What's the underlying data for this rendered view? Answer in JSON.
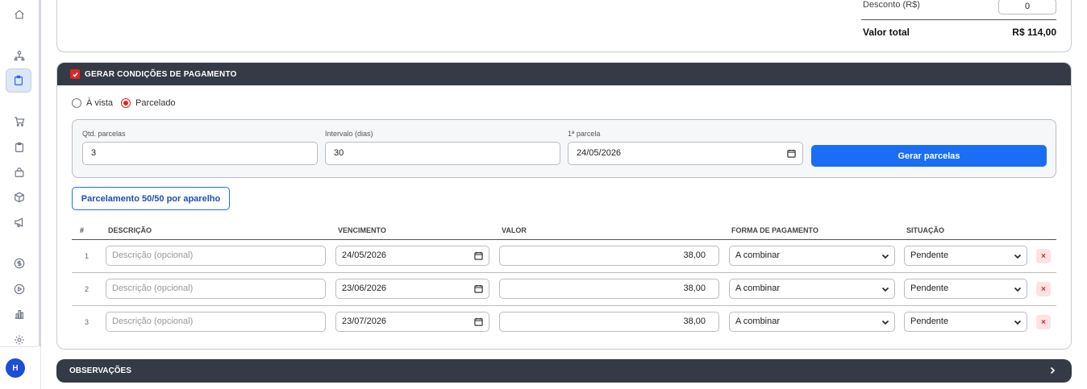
{
  "sidebar": {
    "icons": [
      "home-icon",
      "org-chart-icon",
      "clipboard-icon",
      "cart-icon",
      "clipboard-list-icon",
      "bag-icon",
      "box-icon",
      "megaphone-icon",
      "dollar-icon",
      "play-circle-icon",
      "bar-chart-icon",
      "gear-icon"
    ],
    "avatar_initial": "H"
  },
  "summary": {
    "discount_label": "Desconto (R$)",
    "discount_value": "0",
    "total_label": "Valor total",
    "total_value": "R$ 114,00"
  },
  "payment": {
    "header": "GERAR CONDIÇÕES DE PAGAMENTO",
    "header_checked": true,
    "radio_options": [
      {
        "label": "À vista",
        "selected": false
      },
      {
        "label": "Parcelado",
        "selected": true
      }
    ],
    "qtd_label": "Qtd. parcelas",
    "qtd_value": "3",
    "interval_label": "Intervalo (dias)",
    "interval_value": "30",
    "first_label": "1ª parcela",
    "first_value": "24/05/2026",
    "generate_button": "Gerar parcelas",
    "split_button": "Parcelamento 50/50 por aparelho",
    "columns": {
      "num": "#",
      "desc": "DESCRIÇÃO",
      "due": "VENCIMENTO",
      "value": "VALOR",
      "method": "FORMA DE PAGAMENTO",
      "status": "SITUAÇÃO"
    },
    "rows": [
      {
        "num": "1",
        "desc_placeholder": "Descrição (opcional)",
        "due": "24/05/2026",
        "value": "38,00",
        "method": "A combinar",
        "status": "Pendente",
        "delete": "×"
      },
      {
        "num": "2",
        "desc_placeholder": "Descrição (opcional)",
        "due": "23/06/2026",
        "value": "38,00",
        "method": "A combinar",
        "status": "Pendente",
        "delete": "×"
      },
      {
        "num": "3",
        "desc_placeholder": "Descrição (opcional)",
        "due": "23/07/2026",
        "value": "38,00",
        "method": "A combinar",
        "status": "Pendente",
        "delete": "×"
      }
    ]
  },
  "observations": {
    "header": "OBSERVAÇÕES"
  },
  "colors": {
    "accent": "#1a6ef5",
    "header_bg": "#343a46",
    "danger": "#e02424"
  }
}
